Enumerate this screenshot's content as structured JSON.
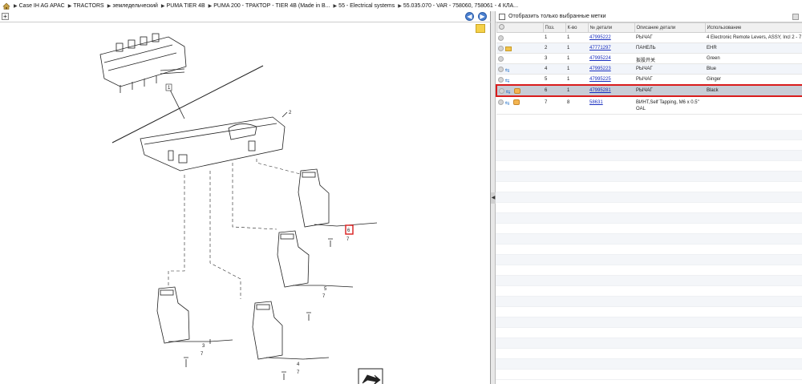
{
  "breadcrumb": [
    {
      "label": "Case IH AG APAC"
    },
    {
      "label": "TRACTORS"
    },
    {
      "label": "земледельческий"
    },
    {
      "label": "PUMA TIER 4B"
    },
    {
      "label": "PUMA 200 - ТРАКТОР - TIER 4B (Made in B..."
    },
    {
      "label": "55 - Electrical systems"
    },
    {
      "label": "55.035.070 - VAR - 758060, 758061 - 4 КЛА..."
    }
  ],
  "diagram": {
    "callouts": [
      "1",
      "2",
      "3",
      "4",
      "5",
      "6",
      "7",
      "7",
      "7",
      "7"
    ]
  },
  "filter": {
    "label": "Отобразить только выбранные метки"
  },
  "table": {
    "headers": [
      "Поз.",
      "К-во",
      "№ детали",
      "Описание детали",
      "Использование"
    ],
    "rows": [
      {
        "pos": "1",
        "qty": "1",
        "part": "47995222",
        "desc": "РЫЧАГ",
        "usage": "4 Electronic Remote Levers, ASSY, Incl 2 - 7"
      },
      {
        "pos": "2",
        "qty": "1",
        "part": "47771297",
        "desc": "ПАНЕЛЬ",
        "usage": "EHR"
      },
      {
        "pos": "3",
        "qty": "1",
        "part": "47995224",
        "desc": "扳股开关",
        "usage": "Green"
      },
      {
        "pos": "4",
        "qty": "1",
        "part": "47995223",
        "desc": "РЫЧАГ",
        "usage": "Blue"
      },
      {
        "pos": "5",
        "qty": "1",
        "part": "47995225",
        "desc": "РЫЧАГ",
        "usage": "Ginger"
      },
      {
        "pos": "6",
        "qty": "1",
        "part": "47995281",
        "desc": "РЫЧАГ",
        "usage": "Black"
      },
      {
        "pos": "7",
        "qty": "8",
        "part": "58631",
        "desc": "ВИНТ,Self Tapping, M6 x 0.5\" OAL",
        "usage": ""
      }
    ]
  }
}
